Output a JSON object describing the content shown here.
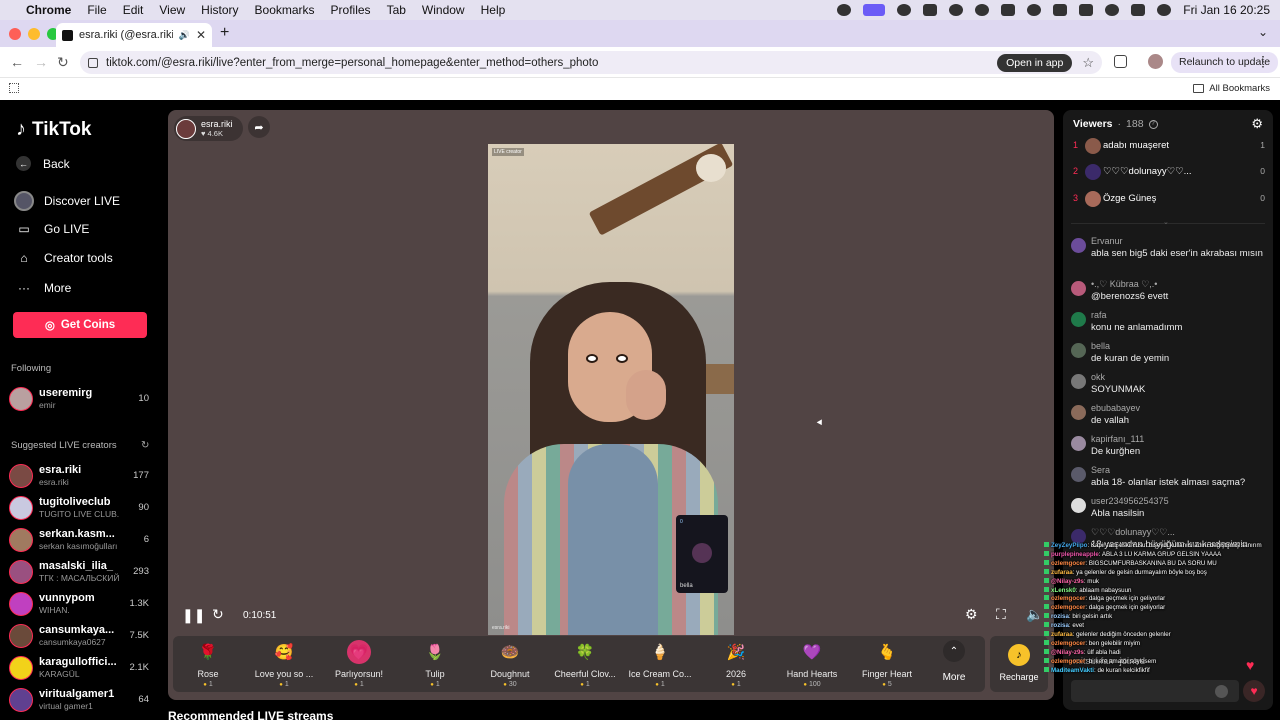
{
  "menubar": {
    "app": "Chrome",
    "items": [
      "File",
      "Edit",
      "View",
      "History",
      "Bookmarks",
      "Profiles",
      "Tab",
      "Window",
      "Help"
    ],
    "clock": "Fri Jan 16  20:25"
  },
  "browser": {
    "tab_title": "esra.riki (@esra.riki) is LIVE",
    "url": "tiktok.com/@esra.riki/live?enter_from_merge=personal_homepage&enter_method=others_photo",
    "open_in_app": "Open in app",
    "relaunch": "Relaunch to update",
    "all_bookmarks": "All Bookmarks"
  },
  "sidebar": {
    "logo": "TikTok",
    "nav": [
      {
        "label": "Back",
        "icon": "back-arrow-icon"
      },
      {
        "label": "Discover LIVE",
        "icon": "discover-icon"
      },
      {
        "label": "Go LIVE",
        "icon": "camera-icon"
      },
      {
        "label": "Creator tools",
        "icon": "home-icon"
      },
      {
        "label": "More",
        "icon": "ellipsis-icon"
      }
    ],
    "get_coins": "Get Coins",
    "following_title": "Following",
    "following": [
      {
        "name": "useremirg",
        "sub": "emir",
        "count": "10"
      }
    ],
    "suggested_title": "Suggested LIVE creators",
    "suggested": [
      {
        "name": "esra.riki",
        "sub": "esra.riki",
        "count": "177"
      },
      {
        "name": "tugitoliveclub",
        "sub": "TUGITO LIVE CLUB...",
        "count": "90"
      },
      {
        "name": "serkan.kasm...",
        "sub": "serkan kasımoğulları",
        "count": "6"
      },
      {
        "name": "masalski_ilia_",
        "sub": "ТГК : МАСАЛЬСКИЙ",
        "count": "293"
      },
      {
        "name": "vunnypom",
        "sub": "WIHAN.",
        "count": "1.3K"
      },
      {
        "name": "cansumkaya...",
        "sub": "cansumkaya0627",
        "count": "7.5K"
      },
      {
        "name": "karagulloffici...",
        "sub": "KARAGÜL",
        "count": "2.1K"
      },
      {
        "name": "viritualgamer1",
        "sub": "virtual gamer1",
        "count": "64"
      }
    ]
  },
  "stream": {
    "host_name": "esra.riki",
    "host_likes": "4.6K",
    "live_tag": "LIVE creator",
    "watermark": "esra.riki",
    "guest_name": "bella",
    "guest_mic": "0",
    "elapsed": "0:10:51"
  },
  "gifts": [
    {
      "name": "Rose",
      "price": "1",
      "emoji": "🌹",
      "bg": "#3b3535"
    },
    {
      "name": "Love you so ...",
      "price": "1",
      "emoji": "🥰",
      "bg": "#3b3535"
    },
    {
      "name": "Parlıyorsun!",
      "price": "1",
      "emoji": "💗",
      "bg": "#d8336b"
    },
    {
      "name": "Tulip",
      "price": "1",
      "emoji": "🌷",
      "bg": "#3b3535"
    },
    {
      "name": "Doughnut",
      "price": "30",
      "emoji": "🍩",
      "bg": "#3b3535"
    },
    {
      "name": "Cheerful Clov...",
      "price": "1",
      "emoji": "🍀",
      "bg": "#3b3535"
    },
    {
      "name": "Ice Cream Co...",
      "price": "1",
      "emoji": "🍦",
      "bg": "#3b3535"
    },
    {
      "name": "2026",
      "price": "1",
      "emoji": "🎉",
      "bg": "#3b3535"
    },
    {
      "name": "Hand Hearts",
      "price": "100",
      "emoji": "💜",
      "bg": "#3b3535"
    },
    {
      "name": "Finger Heart",
      "price": "5",
      "emoji": "🫰",
      "bg": "#3b3535"
    }
  ],
  "more_label": "More",
  "recharge_label": "Recharge",
  "recommended_title": "Recommended LIVE streams",
  "panel": {
    "viewers_label": "Viewers",
    "viewers_count": "188",
    "ranks": [
      {
        "num": "1",
        "name": "adabı muaşeret",
        "score": "1",
        "color": "#8a5a4a"
      },
      {
        "num": "2",
        "name": "♡♡♡dolunayy♡♡...",
        "score": "0",
        "color": "#3b2a6a"
      },
      {
        "num": "3",
        "name": "Özge Güneş",
        "score": "0",
        "color": "#a86a5a"
      }
    ],
    "comments": [
      {
        "user": "Ervanur",
        "text": "abla sen big5 daki eser'in akrabası mısın",
        "color": "#6b4c9a"
      },
      {
        "user": "•.,♡ Kübraa ♡,.•",
        "text": "@berenozs6 evett",
        "color": "#b85a7a"
      },
      {
        "user": "rafa",
        "text": "konu ne anlamadımm",
        "color": "#1f7a4a"
      },
      {
        "user": "bella",
        "text": "de kuran de yemin",
        "color": "#565"
      },
      {
        "user": "okk",
        "text": "SOYUNMAK",
        "color": "#777"
      },
      {
        "user": "ebubabayev",
        "text": "de vallah",
        "color": "#8a6a5a"
      },
      {
        "user": "kapirfanı_111",
        "text": "De kurğhen",
        "color": "#9a8aa0"
      },
      {
        "user": "Sera",
        "text": "abla 18- olanlar istek alması saçma?",
        "color": "#5a5a6a"
      },
      {
        "user": "user234956254375",
        "text": "Abla nasilsin",
        "color": "#ddd"
      },
      {
        "user": "♡♡♡dolunayy♡♡...",
        "text": "18 yaşından büyüğüm kız kardeşimin",
        "color": "#3b2a6a"
      }
    ],
    "joined_user": "mitsui.fan",
    "joined": "joined"
  },
  "overlay_chat": [
    {
      "u": "ZeyZeyPiipo",
      "t": ": Kapir fanı eski Yusuf bişeydi kullanıcı adını değiştirmiş sanırım",
      "c": "#4ae"
    },
    {
      "u": "purplepineapple",
      "t": ": ABLA 3 LÜ KARMA GRUP GELSİN YAAAA",
      "c": "#e5a"
    },
    {
      "u": "ozlemgocer",
      "t": ": BİGSCUMFURBASKANINA BU DA SORU MU",
      "c": "#f84"
    },
    {
      "u": "zufaraa",
      "t": ": ya gelenler de gelsin durmayalım böyle boş boş",
      "c": "#fb4"
    },
    {
      "u": "@Nilay-z9s",
      "t": ": muk",
      "c": "#f6a"
    },
    {
      "u": "xLensk0",
      "t": ": ablaam nabaysuun",
      "c": "#8f8"
    },
    {
      "u": "ozlemgocer",
      "t": ": dalga geçmek için geliyorlar",
      "c": "#f84"
    },
    {
      "u": "ozlemgocer",
      "t": ": dalga geçmek için geliyorlar",
      "c": "#f84"
    },
    {
      "u": "rozisa",
      "t": ": biri gelsin artık",
      "c": "#9cf"
    },
    {
      "u": "rozisa",
      "t": ": evet",
      "c": "#9cf"
    },
    {
      "u": "zufaraa",
      "t": ": gelenler dediğim önceden gelenler",
      "c": "#fb4"
    },
    {
      "u": "ozlemgocer",
      "t": ": ben gelebilir miyim",
      "c": "#f84"
    },
    {
      "u": "@Nilay-z9s",
      "t": ": ülf abla hadi",
      "c": "#f6a"
    },
    {
      "u": "ozlemgocer",
      "t": ": bi kere amatör söylesem",
      "c": "#f84"
    },
    {
      "u": "MaditeamVakti",
      "t": ": de kuran kelcikfikfif",
      "c": "#4cf"
    }
  ]
}
